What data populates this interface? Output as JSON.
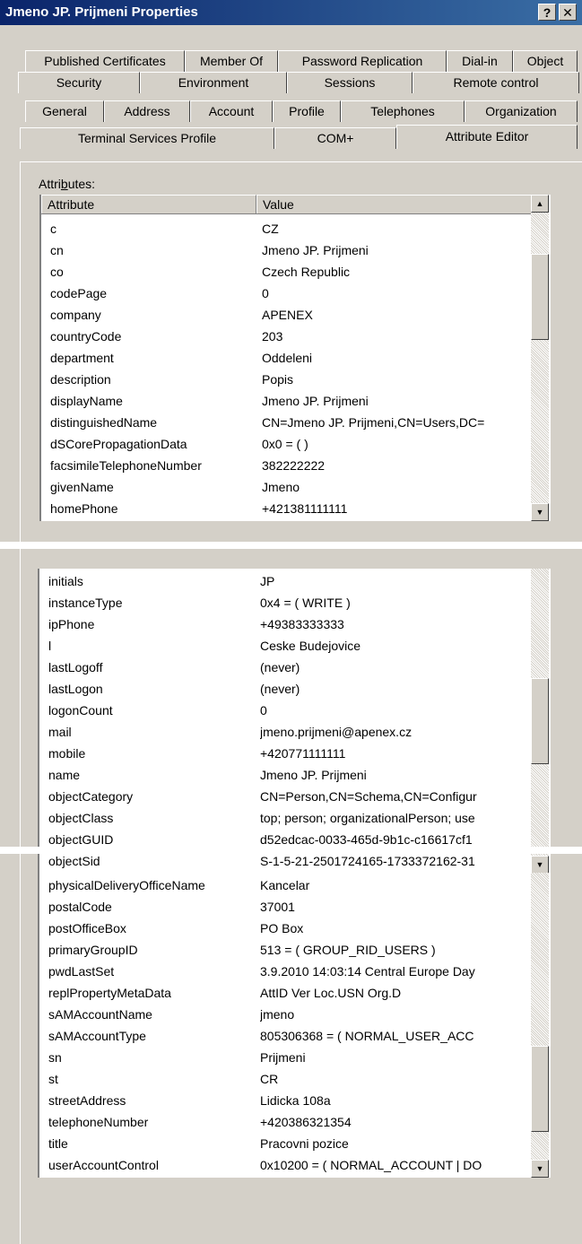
{
  "window": {
    "title": "Jmeno JP. Prijmeni Properties",
    "help_label": "?",
    "close_label": "✕"
  },
  "tabs": {
    "row1": [
      "Published Certificates",
      "Member Of",
      "Password Replication",
      "Dial-in",
      "Object"
    ],
    "row2": [
      "Security",
      "Environment",
      "Sessions",
      "Remote control"
    ],
    "row3": [
      "General",
      "Address",
      "Account",
      "Profile",
      "Telephones",
      "Organization"
    ],
    "row4": [
      "Terminal Services Profile",
      "COM+",
      "Attribute Editor"
    ]
  },
  "attributes_label": {
    "pre": "Attri",
    "accel": "b",
    "post": "utes:"
  },
  "columns": {
    "attribute": "Attribute",
    "value": "Value"
  },
  "panels": [
    {
      "rows": [
        [
          "c",
          "CZ"
        ],
        [
          "cn",
          "Jmeno JP. Prijmeni"
        ],
        [
          "co",
          "Czech Republic"
        ],
        [
          "codePage",
          "0"
        ],
        [
          "company",
          "APENEX"
        ],
        [
          "countryCode",
          "203"
        ],
        [
          "department",
          "Oddeleni"
        ],
        [
          "description",
          "Popis"
        ],
        [
          "displayName",
          "Jmeno JP. Prijmeni"
        ],
        [
          "distinguishedName",
          "CN=Jmeno JP. Prijmeni,CN=Users,DC="
        ],
        [
          "dSCorePropagationData",
          "0x0 = ( )"
        ],
        [
          "facsimileTelephoneNumber",
          "382222222"
        ],
        [
          "givenName",
          "Jmeno"
        ],
        [
          "homePhone",
          "+421381111111"
        ]
      ]
    },
    {
      "rows": [
        [
          "initials",
          "JP"
        ],
        [
          "instanceType",
          "0x4 = ( WRITE )"
        ],
        [
          "ipPhone",
          "+49383333333"
        ],
        [
          "l",
          "Ceske Budejovice"
        ],
        [
          "lastLogoff",
          "(never)"
        ],
        [
          "lastLogon",
          "(never)"
        ],
        [
          "logonCount",
          "0"
        ],
        [
          "mail",
          "jmeno.prijmeni@apenex.cz"
        ],
        [
          "mobile",
          "+420771111111"
        ],
        [
          "name",
          "Jmeno JP. Prijmeni"
        ],
        [
          "objectCategory",
          "CN=Person,CN=Schema,CN=Configur"
        ],
        [
          "objectClass",
          "top; person; organizationalPerson; use"
        ],
        [
          "objectGUID",
          "d52edcac-0033-465d-9b1c-c16617cf1"
        ],
        [
          "objectSid",
          "S-1-5-21-2501724165-1733372162-31"
        ]
      ]
    },
    {
      "rows": [
        [
          "physicalDeliveryOfficeName",
          "Kancelar"
        ],
        [
          "postalCode",
          "37001"
        ],
        [
          "postOfficeBox",
          "PO Box"
        ],
        [
          "primaryGroupID",
          "513 = ( GROUP_RID_USERS )"
        ],
        [
          "pwdLastSet",
          "3.9.2010 14:03:14 Central Europe Day"
        ],
        [
          "replPropertyMetaData",
          "AttID  Ver   Loc.USN              Org.D"
        ],
        [
          "sAMAccountName",
          "jmeno"
        ],
        [
          "sAMAccountType",
          "805306368 = ( NORMAL_USER_ACC"
        ],
        [
          "sn",
          "Prijmeni"
        ],
        [
          "st",
          "CR"
        ],
        [
          "streetAddress",
          "Lidicka 108a"
        ],
        [
          "telephoneNumber",
          "+420386321354"
        ],
        [
          "title",
          "Pracovni pozice"
        ],
        [
          "userAccountControl",
          "0x10200 = ( NORMAL_ACCOUNT | DO"
        ]
      ]
    }
  ],
  "scroll_positions": [
    0.2,
    0.5,
    0.85
  ]
}
